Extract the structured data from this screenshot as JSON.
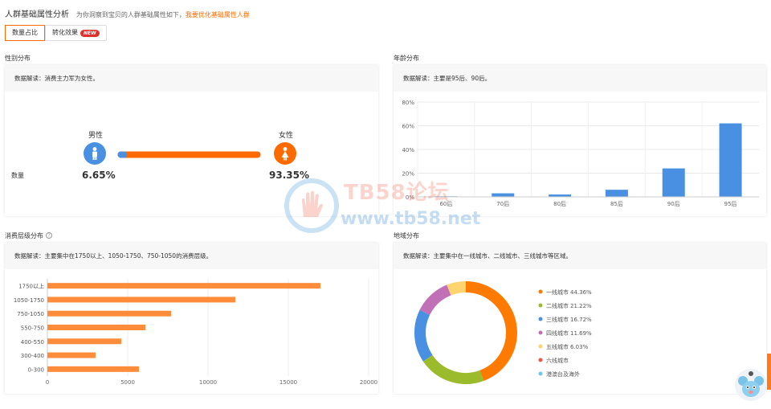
{
  "header": {
    "title": "人群基础属性分析",
    "desc": "为你洞察到宝贝的人群基础属性如下，",
    "link": "我要优化基础属性人群"
  },
  "tabs": [
    {
      "label": "数量占比",
      "active": true
    },
    {
      "label": "转化效果",
      "badge": "NEW"
    }
  ],
  "gender": {
    "title": "性别分布",
    "note": "数据解读：消费主力军为女性。",
    "row_label": "数量",
    "male": {
      "label": "男性",
      "pct": "6.65%",
      "value": 6.65
    },
    "female": {
      "label": "女性",
      "pct": "93.35%",
      "value": 93.35
    },
    "colors": {
      "male": "#4a90e2",
      "female": "#ff6a00"
    }
  },
  "age": {
    "title": "年龄分布",
    "note": "数据解读：主要是95后、90后。"
  },
  "consumption": {
    "title": "消费层级分布",
    "note": "数据解读：主要集中在1750以上、1050-1750、750-1050的消费层级。"
  },
  "region": {
    "title": "地域分布",
    "note": "数据解读：主要集中在一线城市、二线城市、三线城市等区域。"
  },
  "watermark": {
    "title": "TB58论坛",
    "url": "www.tb58.net"
  },
  "chart_data": [
    {
      "type": "bar",
      "name_key": "age",
      "categories": [
        "60后",
        "70后",
        "80后",
        "85后",
        "90后",
        "95后"
      ],
      "values": [
        0.5,
        3,
        2,
        6,
        24,
        62
      ],
      "ylim": [
        0,
        80
      ],
      "yticks": [
        "0%",
        "20%",
        "40%",
        "60%",
        "80%"
      ],
      "color": "#4a90e2",
      "grid": true
    },
    {
      "type": "bar",
      "orientation": "horizontal",
      "name_key": "consumption",
      "categories": [
        "1750以上",
        "1050-1750",
        "750-1050",
        "550-750",
        "400-550",
        "300-400",
        "0-300"
      ],
      "values": [
        17000,
        11700,
        7700,
        6100,
        4600,
        3000,
        5700
      ],
      "xlim": [
        0,
        20000
      ],
      "xticks": [
        "0",
        "5000",
        "10000",
        "15000",
        "20000"
      ],
      "color": "#ff8c3a"
    },
    {
      "type": "pie",
      "name_key": "region",
      "donut": true,
      "legend_position": "right",
      "slices": [
        {
          "label": "一线城市",
          "pct_label": "44.36%",
          "value": 44.36,
          "color": "#ff7a00"
        },
        {
          "label": "二线城市",
          "pct_label": "21.22%",
          "value": 21.22,
          "color": "#9bbb2c"
        },
        {
          "label": "三线城市",
          "pct_label": "16.72%",
          "value": 16.72,
          "color": "#4a90e2"
        },
        {
          "label": "四线城市",
          "pct_label": "11.69%",
          "value": 11.69,
          "color": "#c170b8"
        },
        {
          "label": "五线城市",
          "pct_label": "6.03%",
          "value": 6.03,
          "color": "#ffd36e"
        },
        {
          "label": "六线城市",
          "pct_label": "",
          "value": 0,
          "color": "#f05545"
        },
        {
          "label": "港澳台及海外",
          "pct_label": "",
          "value": 0,
          "color": "#6bc8f0"
        }
      ]
    }
  ]
}
